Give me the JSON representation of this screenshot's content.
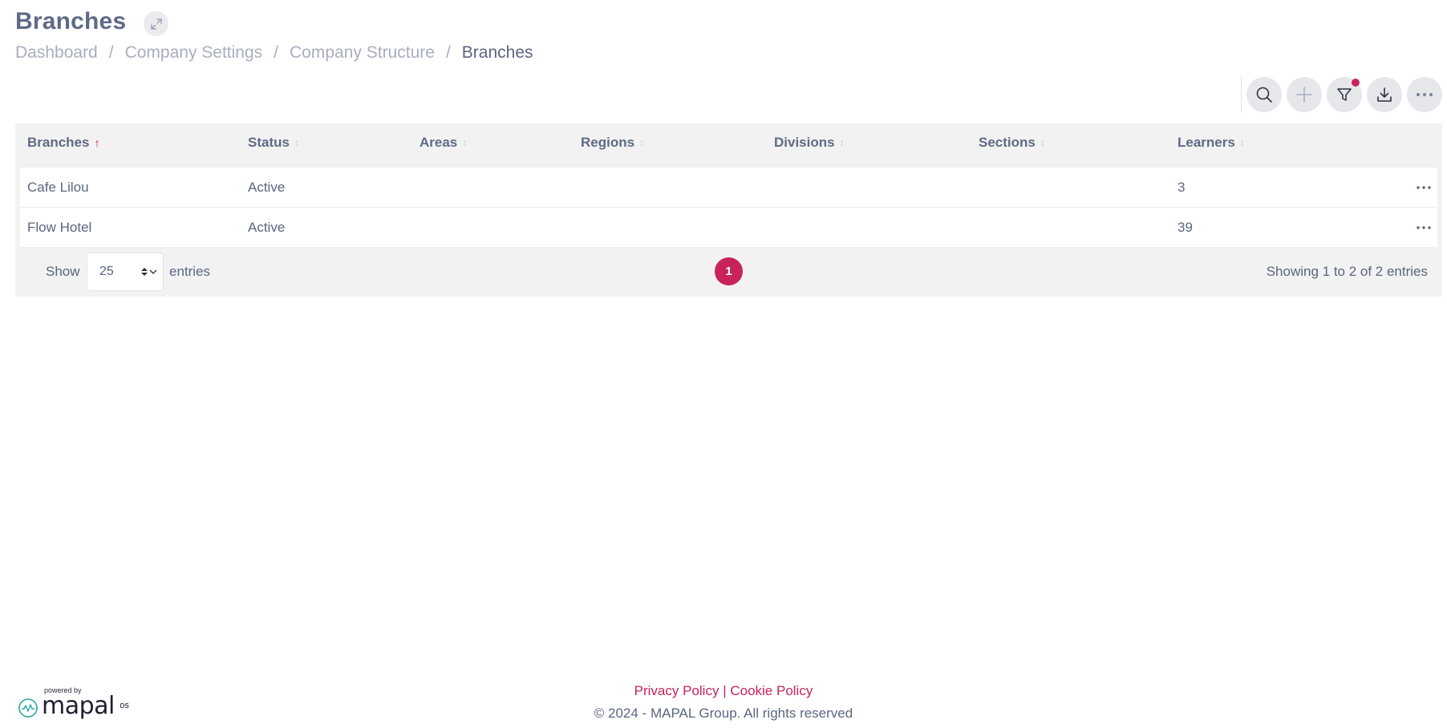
{
  "page": {
    "title": "Branches"
  },
  "breadcrumb": [
    {
      "label": "Dashboard"
    },
    {
      "label": "Company Settings"
    },
    {
      "label": "Company Structure"
    },
    {
      "label": "Branches"
    }
  ],
  "breadcrumb_separator": "/",
  "toolbar": {
    "icons": [
      "search-icon",
      "plus-icon",
      "filter-icon",
      "download-icon",
      "more-icon"
    ],
    "filter_active": true
  },
  "table": {
    "columns": [
      {
        "label": "Branches",
        "sort": "asc"
      },
      {
        "label": "Status",
        "sort": "none"
      },
      {
        "label": "Areas",
        "sort": "none"
      },
      {
        "label": "Regions",
        "sort": "none"
      },
      {
        "label": "Divisions",
        "sort": "none"
      },
      {
        "label": "Sections",
        "sort": "none"
      },
      {
        "label": "Learners",
        "sort": "none"
      }
    ],
    "rows": [
      {
        "branch": "Cafe Lilou",
        "status": "Active",
        "areas": "",
        "regions": "",
        "divisions": "",
        "sections": "",
        "learners": "3"
      },
      {
        "branch": "Flow Hotel",
        "status": "Active",
        "areas": "",
        "regions": "",
        "divisions": "",
        "sections": "",
        "learners": "39"
      }
    ]
  },
  "pagination": {
    "show_label": "Show",
    "entries_value": "25",
    "entries_label": "entries",
    "current_page": "1",
    "summary": "Showing 1 to 2 of 2 entries"
  },
  "footer": {
    "privacy": "Privacy Policy",
    "divider": "|",
    "cookie": "Cookie Policy",
    "copyright": "© 2024 - MAPAL Group. All rights reserved"
  },
  "logo": {
    "powered_by": "powered by",
    "brand": "mapal",
    "suffix": "os"
  },
  "colors": {
    "accent": "#c7235a",
    "text": "#5b6580",
    "muted": "#a8aec0",
    "table_bg": "#f2f2f2"
  }
}
